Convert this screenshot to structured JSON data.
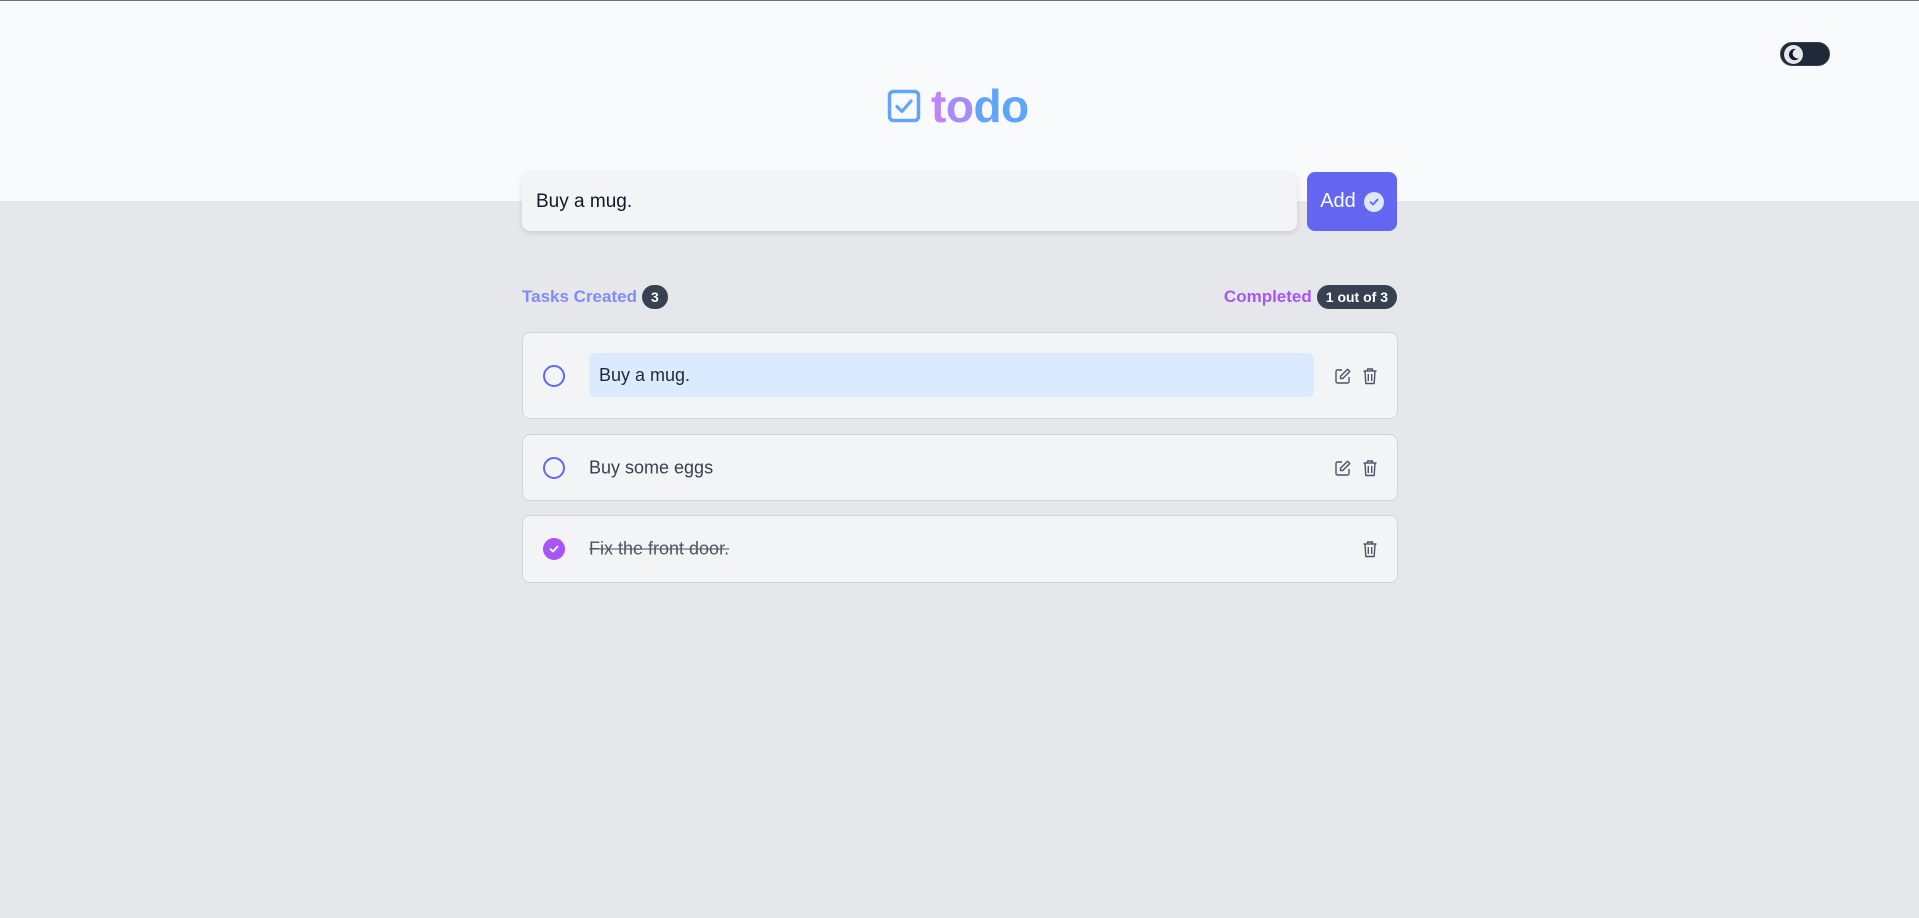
{
  "app": {
    "logo_part1": "t",
    "logo_part2": "o",
    "logo_part3": "do"
  },
  "theme_toggle": {
    "icon": "moon-icon",
    "state": "dark"
  },
  "new_task": {
    "value": "Buy a mug.",
    "add_label": "Add"
  },
  "stats": {
    "created_label": "Tasks Created",
    "created_count": "3",
    "completed_label": "Completed",
    "completed_count": "1 out of 3"
  },
  "tasks": [
    {
      "text": "Buy a mug.",
      "completed": false,
      "editing": true
    },
    {
      "text": "Buy some eggs",
      "completed": false,
      "editing": false
    },
    {
      "text": "Fix the front door.",
      "completed": true,
      "editing": false
    }
  ],
  "colors": {
    "accent": "#6366f1",
    "completed": "#a855f7",
    "created_label": "#818cf8",
    "badge": "#374151"
  }
}
